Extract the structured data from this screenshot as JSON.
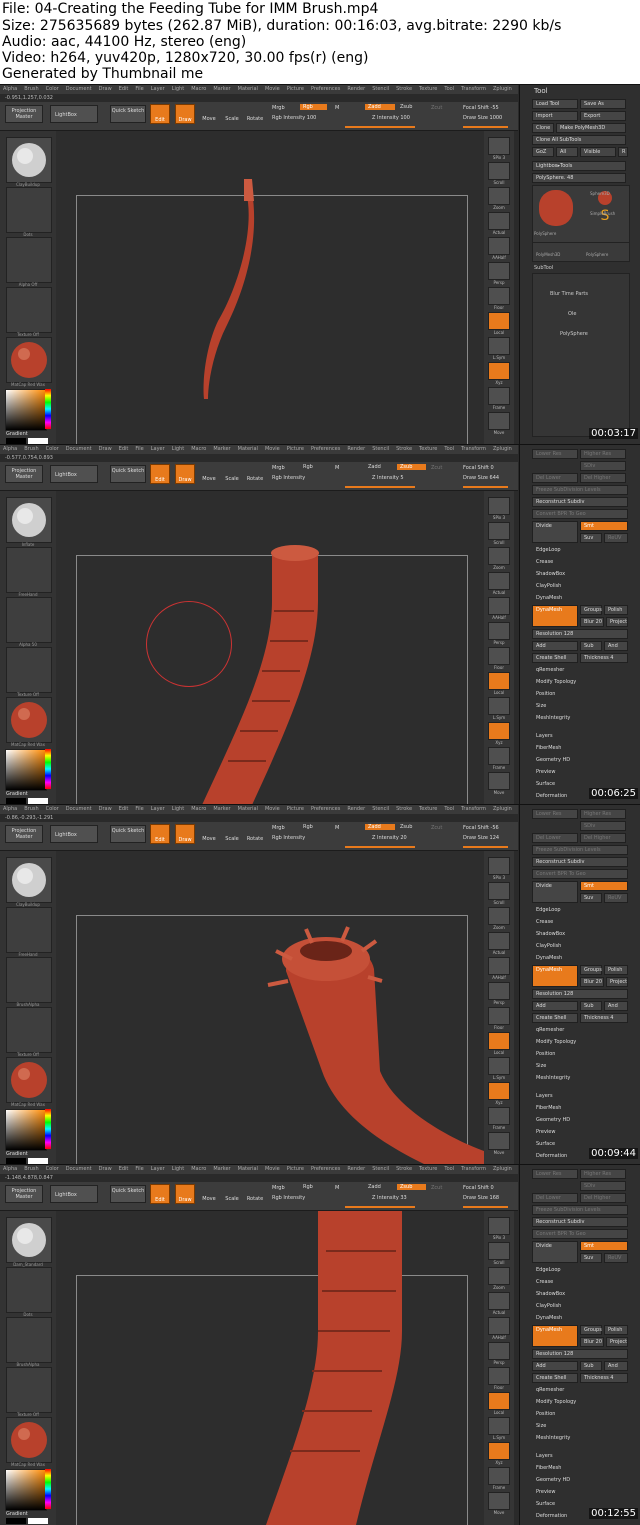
{
  "header": {
    "lines": [
      "File: 04-Creating the Feeding Tube for IMM Brush.mp4",
      "Size: 275635689 bytes (262.87 MiB), duration: 00:16:03, avg.bitrate: 2290 kb/s",
      "Audio: aac, 44100 Hz, stereo (eng)",
      "Video: h264, yuv420p, 1280x720, 30.00 fps(r) (eng)",
      "Generated by Thumbnail me"
    ]
  },
  "menu": [
    "Alpha",
    "Brush",
    "Color",
    "Document",
    "Draw",
    "Edit",
    "File",
    "Layer",
    "Light",
    "Macro",
    "Marker",
    "Material",
    "Movie",
    "Picture",
    "Preferences",
    "Render",
    "Stencil",
    "Stroke",
    "Texture",
    "Tool",
    "Transform",
    "Zplugin",
    "Zscript"
  ],
  "toolbar": {
    "projection_master": "Projection Master",
    "lightbox": "LightBox",
    "quick_sketch": "Quick Sketch",
    "edit": "Edit",
    "draw": "Draw",
    "move": "Move",
    "scale": "Scale",
    "rotate": "Rotate",
    "mrgb": "Mrgb",
    "rgb": "Rgb",
    "m": "M",
    "rgb_intensity": "Rgb Intensity",
    "zadd": "Zadd",
    "zsub": "Zsub",
    "zcut": "Zcut",
    "z_intensity": "Z Intensity",
    "focal_shift": "Focal Shift",
    "draw_size": "Draw Size"
  },
  "right_icons": [
    "SPix 3",
    "Scroll",
    "Zoom",
    "Actual",
    "AAHalf",
    "Persp",
    "Floor",
    "Local",
    "L.Sym",
    "Xyz",
    "Frame",
    "Move"
  ],
  "frames": [
    {
      "timestamp": "00:03:17",
      "coords": "-0.951,1.257,0.032",
      "rgb_intensity": "100",
      "z_intensity": "100",
      "focal_shift": "-55",
      "draw_size": "1000",
      "rgb_active": true,
      "zadd_active": true,
      "zsub_active": false,
      "thumbs": [
        "ClayBuildup",
        "Dots",
        "Alpha Off",
        "Texture Off",
        "MatCap Red Wax"
      ],
      "panel": {
        "title": "Tool",
        "load_tool": "Load Tool",
        "save_as": "Save As",
        "import": "Import",
        "export": "Export",
        "clone": "Clone",
        "make_polymesh": "Make PolyMesh3D",
        "clone_all": "Clone All SubTools",
        "goz": "GoZ",
        "all": "All",
        "visible": "Visible",
        "r": "R",
        "lightbox_tools": "Lightbox▸Tools",
        "polysphere": "PolySphere. 48",
        "tool_names": [
          "PolySphere",
          "Sphere3D",
          "SimpleBrush",
          "PolyMesh3D",
          "PolySphere"
        ],
        "subtool": "SubTool",
        "subtool_items": [
          "Blur Time Parts",
          "Ole",
          "PolySphere"
        ]
      }
    },
    {
      "timestamp": "00:06:25",
      "coords": "-0.577,0.754,0.893",
      "rgb_intensity": "",
      "z_intensity": "5",
      "focal_shift": "0",
      "draw_size": "644",
      "rgb_active": false,
      "zadd_active": false,
      "zsub_active": true,
      "thumbs": [
        "Inflate",
        "FreeHand",
        "Alpha 50",
        "Texture Off",
        "MatCap Red Wax"
      ]
    },
    {
      "timestamp": "00:09:44",
      "coords": "-0.86,-0.293,-1.291",
      "rgb_intensity": "",
      "z_intensity": "20",
      "focal_shift": "-56",
      "draw_size": "124",
      "rgb_active": false,
      "zadd_active": true,
      "zsub_active": false,
      "thumbs": [
        "ClayBuildup",
        "FreeHand",
        "BrushAlpha",
        "Texture Off",
        "MatCap Red Wax"
      ]
    },
    {
      "timestamp": "00:12:55",
      "coords": "-1.148,4.878,0.847",
      "rgb_intensity": "",
      "z_intensity": "33",
      "focal_shift": "0",
      "draw_size": "168",
      "rgb_active": false,
      "zadd_active": false,
      "zsub_active": true,
      "thumbs": [
        "Dam_Standard",
        "Dots",
        "BrushAlpha",
        "Texture Off",
        "MatCap Red Wax"
      ]
    }
  ],
  "geometry_panel": {
    "lower_res": "Lower Res",
    "higher_res": "Higher Res",
    "sdiv": "SDiv",
    "del_lower": "Del Lower",
    "del_higher": "Del Higher",
    "freeze": "Freeze SubDivision Levels",
    "reconstruct": "Reconstruct Subdiv",
    "convert_bpr": "Convert BPR To Geo",
    "divide": "Divide",
    "smt": "Smt",
    "suv": "Suv",
    "relief": "ReUV",
    "edgeloop": "EdgeLoop",
    "crease": "Crease",
    "shadowbox": "ShadowBox",
    "claypolish": "ClayPolish",
    "dynamesh_section": "DynaMesh",
    "dynamesh_btn": "DynaMesh",
    "groups": "Groups",
    "polish": "Polish",
    "blur": "Blur 20",
    "project": "Project",
    "resolution": "Resolution 128",
    "add": "Add",
    "sub": "Sub",
    "and": "And",
    "create_shell": "Create Shell",
    "thickness": "Thickness 4",
    "qremesher": "qRemesher",
    "modify_topology": "Modify Topology",
    "position": "Position",
    "size": "Size",
    "meshintegrity": "MeshIntegrity",
    "layers": "Layers",
    "fibermesh": "FiberMesh",
    "geometry_hd": "Geometry HD",
    "preview": "Preview",
    "surface": "Surface",
    "deformation": "Deformation"
  },
  "colors": {
    "accent": "#e87a1c",
    "clay": "#b8412c",
    "ui_bg": "#2f2f2f"
  }
}
